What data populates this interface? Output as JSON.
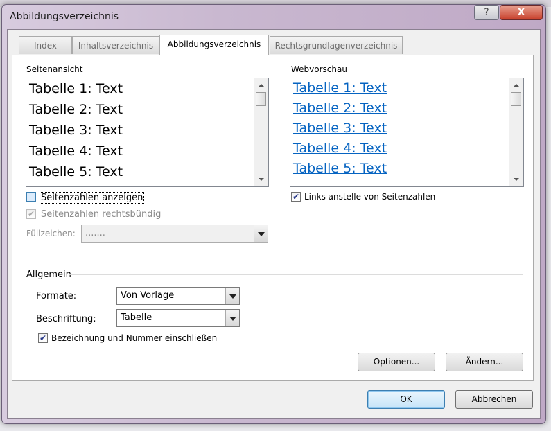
{
  "window": {
    "title": "Abbildungsverzeichnis",
    "help_label": "?",
    "close_label": "X"
  },
  "tabs": [
    {
      "label": "Index"
    },
    {
      "label": "Inhaltsverzeichnis"
    },
    {
      "label": "Abbildungsverzeichnis",
      "selected": true
    },
    {
      "label": "Rechtsgrundlagenverzeichnis"
    }
  ],
  "print_preview": {
    "label": "Seitenansicht",
    "items": [
      "Tabelle 1: Text",
      "Tabelle 2: Text",
      "Tabelle 3: Text",
      "Tabelle 4: Text",
      "Tabelle 5: Text"
    ]
  },
  "web_preview": {
    "label": "Webvorschau",
    "items": [
      "Tabelle 1: Text",
      "Tabelle 2: Text",
      "Tabelle 3: Text",
      "Tabelle 4: Text",
      "Tabelle 5: Text"
    ],
    "link_color": "#0563c1"
  },
  "options": {
    "show_page_numbers": {
      "label": "Seitenzahlen anzeigen",
      "checked": false
    },
    "right_align": {
      "label": "Seitenzahlen rechtsbündig",
      "checked": true,
      "disabled": true
    },
    "tab_leader": {
      "label": "Füllzeichen:",
      "value": ".......",
      "disabled": true
    },
    "use_hyperlinks": {
      "label": "Links anstelle von Seitenzahlen",
      "checked": true
    }
  },
  "general": {
    "heading": "Allgemein",
    "formats": {
      "label": "Formate:",
      "value": "Von Vorlage"
    },
    "caption": {
      "label": "Beschriftung:",
      "value": "Tabelle"
    },
    "include_label": {
      "label": "Bezeichnung und Nummer einschließen",
      "checked": true
    }
  },
  "buttons": {
    "options": "Optionen...",
    "modify": "Ändern...",
    "ok": "OK",
    "cancel": "Abbrechen"
  },
  "check_glyph": "✔"
}
